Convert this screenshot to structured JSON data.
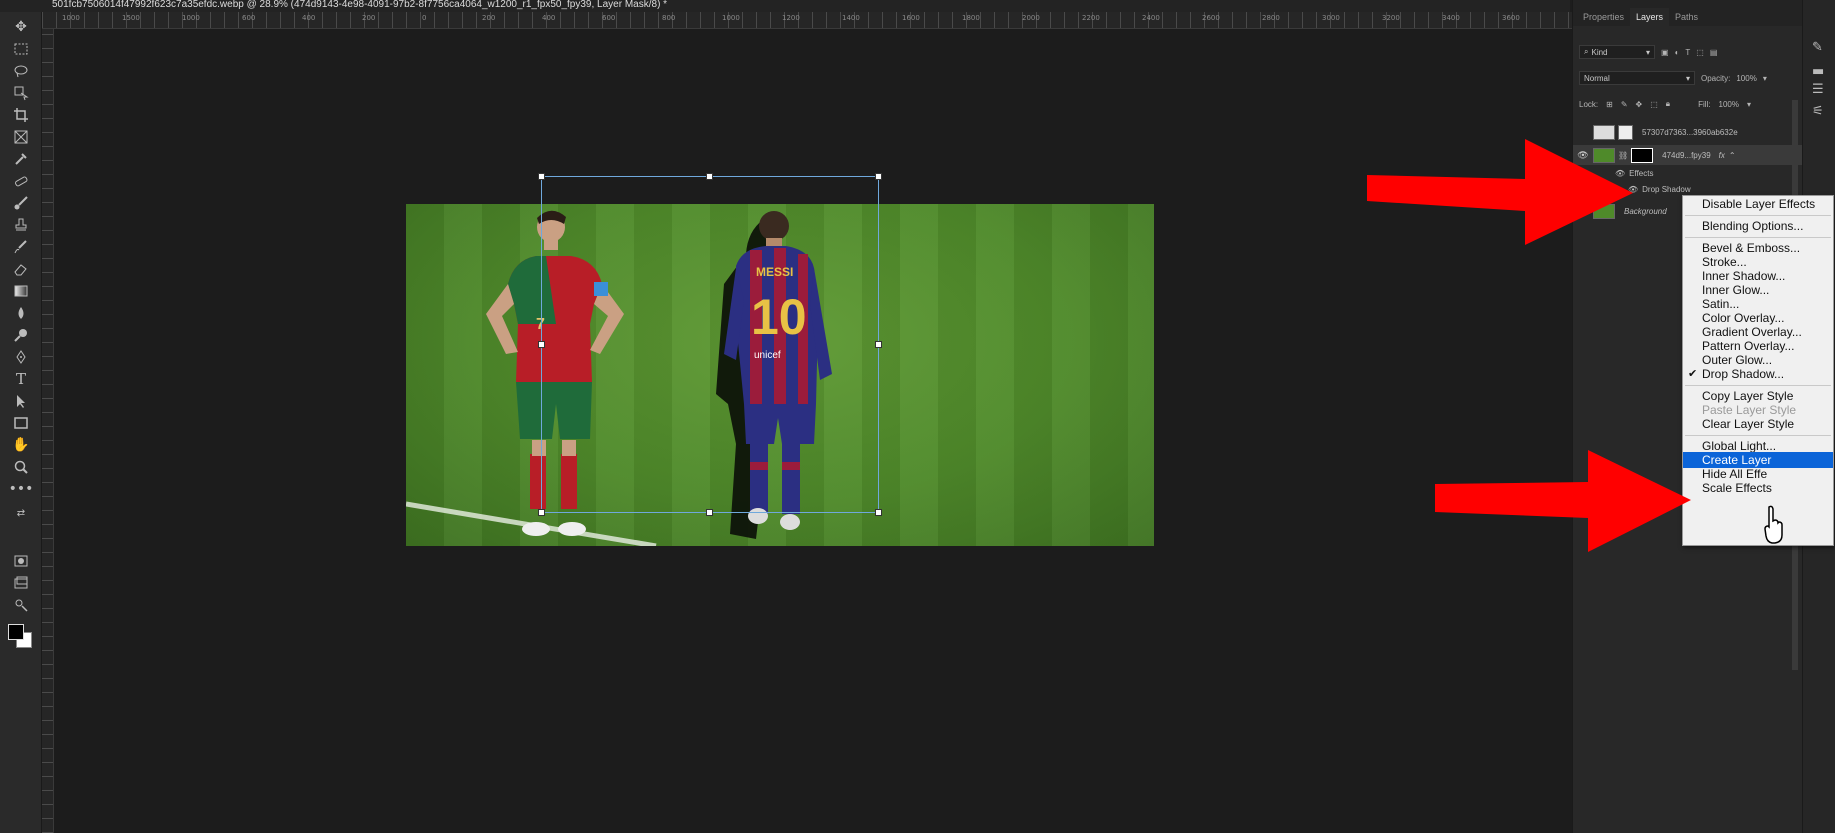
{
  "document": {
    "tab_title": "501fcb7506014f47992f623c7a35efdc.webp @ 28.9% (474d9143-4e98-4091-97b2-8f7756ca4064_w1200_r1_fpx50_fpy39, Layer Mask/8) *"
  },
  "ruler": {
    "labels": [
      "1000",
      "1500",
      "1000",
      "600",
      "400",
      "200",
      "0",
      "200",
      "400",
      "600",
      "800",
      "1000",
      "1200",
      "1400",
      "1600",
      "1800",
      "2000",
      "2200",
      "2400",
      "2600",
      "2800",
      "3000",
      "3200",
      "3400",
      "3600"
    ]
  },
  "panel": {
    "tabs": [
      "Properties",
      "Layers",
      "Paths"
    ],
    "active_tab": "Layers",
    "filter_label": "Kind",
    "blend_mode": "Normal",
    "opacity_label": "Opacity:",
    "opacity_value": "100%",
    "lock_label": "Lock:",
    "fill_label": "Fill:",
    "fill_value": "100%",
    "layers": [
      {
        "name": "57307d7363...3960ab632e",
        "visible": false
      },
      {
        "name": "474d9...fpy39",
        "visible": true,
        "fx": "fx"
      },
      {
        "name": "Effects",
        "visible": true
      },
      {
        "name": "Drop Shadow",
        "visible": true
      },
      {
        "name": "Background",
        "visible": true
      }
    ]
  },
  "context_menu": {
    "items": [
      {
        "label": "Disable Layer Effects",
        "enabled": true
      },
      {
        "label": "Blending Options...",
        "enabled": true
      },
      {
        "label": "Bevel & Emboss...",
        "enabled": true
      },
      {
        "label": "Stroke...",
        "enabled": true
      },
      {
        "label": "Inner Shadow...",
        "enabled": true
      },
      {
        "label": "Inner Glow...",
        "enabled": true
      },
      {
        "label": "Satin...",
        "enabled": true
      },
      {
        "label": "Color Overlay...",
        "enabled": true
      },
      {
        "label": "Gradient Overlay...",
        "enabled": true
      },
      {
        "label": "Pattern Overlay...",
        "enabled": true
      },
      {
        "label": "Outer Glow...",
        "enabled": true
      },
      {
        "label": "Drop Shadow...",
        "enabled": true,
        "checked": true
      },
      {
        "label": "Copy Layer Style",
        "enabled": true
      },
      {
        "label": "Paste Layer Style",
        "enabled": false
      },
      {
        "label": "Clear Layer Style",
        "enabled": true
      },
      {
        "label": "Global Light...",
        "enabled": true
      },
      {
        "label": "Create Layer",
        "enabled": true,
        "highlighted": true
      },
      {
        "label": "Hide All Effe",
        "enabled": true
      },
      {
        "label": "Scale Effects",
        "enabled": true
      }
    ],
    "highlight_color": "#0b64d8"
  },
  "image": {
    "left_player_number": "7",
    "right_player_name": "MESSI",
    "right_player_number": "10",
    "sponsor": "unicef"
  },
  "colors": {
    "annotation_arrow": "#ff0000",
    "selection": "#6fa8dc",
    "pitch": "#4f8a2a"
  },
  "icons": {
    "tools": [
      "move-icon",
      "marquee-icon",
      "lasso-icon",
      "object-select-icon",
      "crop-icon",
      "frame-icon",
      "eyedropper-icon",
      "healing-icon",
      "brush-icon",
      "stamp-icon",
      "history-brush-icon",
      "eraser-icon",
      "gradient-icon",
      "blur-icon",
      "dodge-icon",
      "pen-icon",
      "type-icon",
      "path-select-icon",
      "rectangle-icon",
      "hand-icon",
      "zoom-icon",
      "more-tools-icon"
    ]
  }
}
